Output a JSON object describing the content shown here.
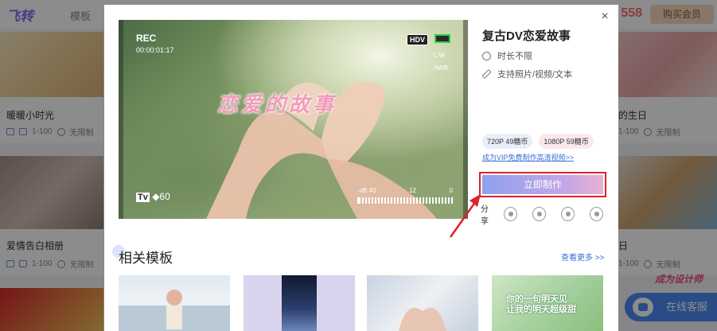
{
  "background": {
    "logo": "飞转",
    "nav_label": "模板",
    "coins": "558",
    "buy_member": "购买会员",
    "cards": [
      {
        "title": "暖暖小时光",
        "count": "1-100",
        "limit": "无限制"
      },
      {
        "title": "爱情告白相册",
        "count": "1-100",
        "limit": "无限制"
      },
      {
        "title": "的生日",
        "count": "1-100",
        "limit": "无限制"
      },
      {
        "title": "日",
        "count": "1-100",
        "limit": "无限制"
      }
    ],
    "online_service": "在线客服",
    "promo": "成为设计师"
  },
  "modal": {
    "close": "×",
    "title": "复古DV恋爱故事",
    "duration": "时长不限",
    "supports": "支持照片/视频/文本",
    "price_720": "720P 49糖币",
    "price_1080": "1080P 59糖币",
    "vip_link": "成为VIP免费制作高清视频>>",
    "make_button": "立即制作",
    "share_label": "分享",
    "share_icons": [
      "sina-icon",
      "qzone-icon",
      "weibo-icon",
      "link-icon"
    ],
    "video": {
      "rec": "REC",
      "timecode": "00:00:01:17",
      "hdv": "HDV",
      "wb": "L W",
      "awb": "AWB",
      "tv": "Tv",
      "tv_value": "60",
      "meter_labels": [
        "-dB 40",
        "12",
        "0"
      ],
      "overlay_text": "恋爱的故事"
    },
    "related_title": "相关模板",
    "more_link": "查看更多 >>",
    "related_cards": [
      {
        "caption": ""
      },
      {
        "caption": ""
      },
      {
        "caption": ""
      },
      {
        "caption": "你的一句明天见\n让我的明天超级甜"
      }
    ]
  }
}
